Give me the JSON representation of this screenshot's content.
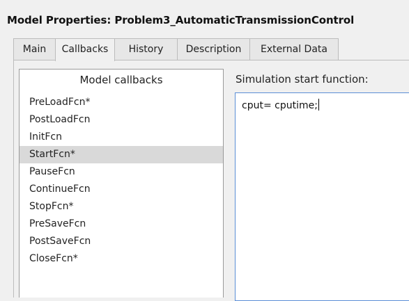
{
  "dialog": {
    "title": "Model Properties: Problem3_AutomaticTransmissionControl"
  },
  "tabs": [
    {
      "label": "Main",
      "active": false
    },
    {
      "label": "Callbacks",
      "active": true
    },
    {
      "label": "History",
      "active": false
    },
    {
      "label": "Description",
      "active": false
    },
    {
      "label": "External Data",
      "active": false
    }
  ],
  "callbacks_panel": {
    "header": "Model callbacks",
    "items": [
      {
        "label": "PreLoadFcn*"
      },
      {
        "label": "PostLoadFcn"
      },
      {
        "label": "InitFcn"
      },
      {
        "label": "StartFcn*",
        "selected": true
      },
      {
        "label": "PauseFcn"
      },
      {
        "label": "ContinueFcn"
      },
      {
        "label": "StopFcn*"
      },
      {
        "label": "PreSaveFcn"
      },
      {
        "label": "PostSaveFcn"
      },
      {
        "label": "CloseFcn*"
      }
    ]
  },
  "function_editor": {
    "label": "Simulation start function:",
    "code": "cput= cputime;"
  },
  "colors": {
    "selected_row": "#d9d9d9",
    "editor_focus_border": "#5b8ed6",
    "window_background": "#f0f0f0"
  }
}
